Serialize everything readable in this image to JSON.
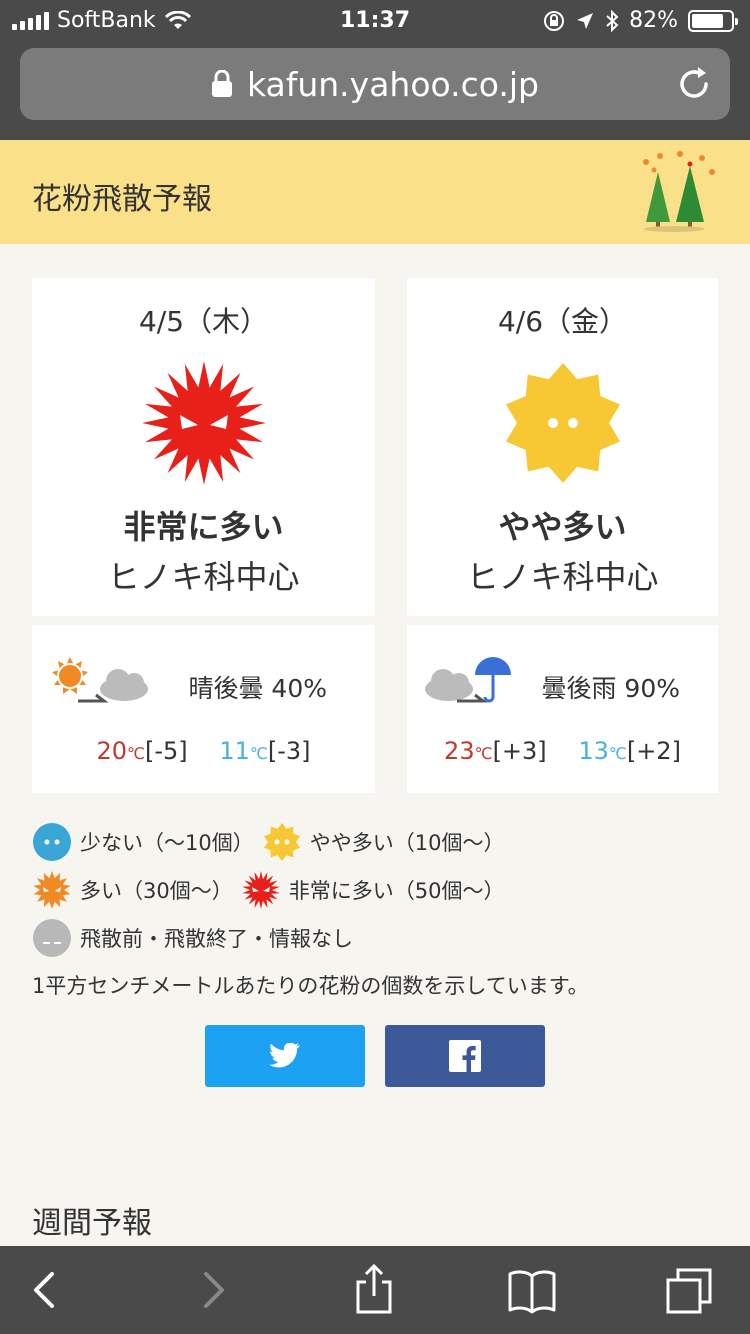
{
  "status_bar": {
    "carrier": "SoftBank",
    "time": "11:37",
    "battery": "82%",
    "battery_level": 0.82
  },
  "browser": {
    "url": "kafun.yahoo.co.jp"
  },
  "header": {
    "title": "花粉飛散予報"
  },
  "days": [
    {
      "date": "4/5（木）",
      "level": "非常に多い",
      "type": "ヒノキ科中心",
      "pollen_icon": "pollen-very-high-icon",
      "weather": "晴後曇 40%",
      "weather_icons": [
        "sun-icon",
        "cloud-icon"
      ],
      "high": "20",
      "high_diff": "[-5]",
      "low": "11",
      "low_diff": "[-3]",
      "unit": "℃"
    },
    {
      "date": "4/6（金）",
      "level": "やや多い",
      "type": "ヒノキ科中心",
      "pollen_icon": "pollen-somewhat-high-icon",
      "weather": "曇後雨 90%",
      "weather_icons": [
        "cloud-icon",
        "umbrella-icon"
      ],
      "high": "23",
      "high_diff": "[+3]",
      "low": "13",
      "low_diff": "[+2]",
      "unit": "℃"
    }
  ],
  "legend": {
    "low": "少ない（〜10個）",
    "somewhat": "やや多い（10個〜）",
    "high": "多い（30個〜）",
    "very_high": "非常に多い（50個〜）",
    "none": "飛散前・飛散終了・情報なし"
  },
  "note": "1平方センチメートルあたりの花粉の個数を示しています。",
  "weekly_title": "週間予報",
  "colors": {
    "header_bg": "#fbe08a",
    "very_high": "#e8201a",
    "somewhat": "#f7c833",
    "high": "#f08a24",
    "low": "#3aa6d6",
    "none": "#b8b8b8",
    "temp_high": "#c0392b",
    "temp_low": "#4ab0dc",
    "twitter": "#1da1f2",
    "facebook": "#3b5998"
  }
}
